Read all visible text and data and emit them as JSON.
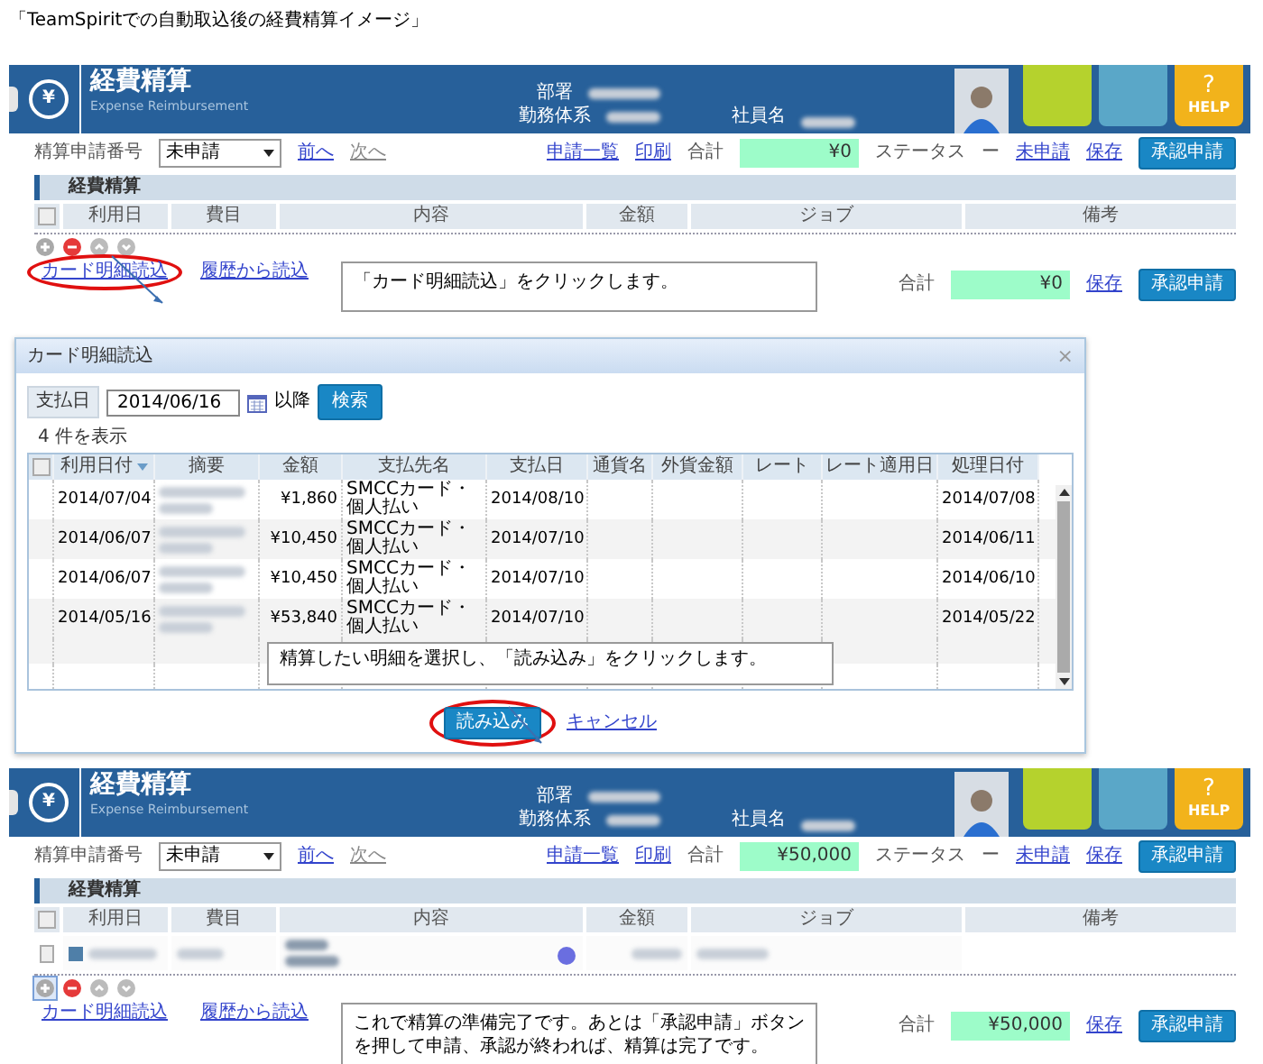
{
  "caption": "「TeamSpiritでの自動取込後の経費精算イメージ」",
  "screens": [
    {
      "header": {
        "yen": "¥",
        "title": "経費精算",
        "subtitle": "Expense Reimbursement",
        "dept_label": "部署",
        "work_label": "勤務体系",
        "employee_label": "社員名",
        "help_mark": "?",
        "help_label": "HELP"
      },
      "toolbar": {
        "number_label": "精算申請番号",
        "number_value": "未申請",
        "prev": "前へ",
        "next": "次へ",
        "list_link": "申請一覧",
        "print_link": "印刷",
        "total_label": "合計",
        "total": "¥0",
        "status_label": "ステータス",
        "status_dash": "ー",
        "status_link": "未申請",
        "save": "保存",
        "submit": "承認申請"
      },
      "section": "経費精算",
      "select_all_checked": false,
      "columns": [
        "利用日",
        "費目",
        "内容",
        "金額",
        "ジョブ",
        "備考"
      ],
      "add_selected": false,
      "card_link": "カード明細読込",
      "card_link_circled": true,
      "history_link": "履歴から読込",
      "callout": "「カード明細読込」をクリックします。",
      "footer": {
        "total_label": "合計",
        "total": "¥0",
        "save": "保存",
        "submit": "承認申請"
      }
    },
    {
      "header": {
        "yen": "¥",
        "title": "経費精算",
        "subtitle": "Expense Reimbursement",
        "dept_label": "部署",
        "work_label": "勤務体系",
        "employee_label": "社員名",
        "help_mark": "?",
        "help_label": "HELP"
      },
      "toolbar": {
        "number_label": "精算申請番号",
        "number_value": "未申請",
        "prev": "前へ",
        "next": "次へ",
        "list_link": "申請一覧",
        "print_link": "印刷",
        "total_label": "合計",
        "total": "¥50,000",
        "status_label": "ステータス",
        "status_dash": "ー",
        "status_link": "未申請",
        "save": "保存",
        "submit": "承認申請"
      },
      "section": "経費精算",
      "select_all_checked": false,
      "columns": [
        "利用日",
        "費目",
        "内容",
        "金額",
        "ジョブ",
        "備考"
      ],
      "rows": [
        {
          "kind": "blurred",
          "checked": false
        }
      ],
      "add_selected": true,
      "card_link": "カード明細読込",
      "card_link_circled": false,
      "history_link": "履歴から読込",
      "callout": "これで精算の準備完了です。あとは「承認申請」ボタンを押して申請、承認が終われば、精算は完了です。",
      "footer": {
        "total_label": "合計",
        "total": "¥50,000",
        "save": "保存",
        "submit": "承認申請"
      }
    }
  ],
  "dialog": {
    "title": "カード明細読込",
    "close": "×",
    "date_label": "支払日",
    "date": "2014/06/16",
    "after": "以降",
    "search": "検索",
    "count": "4 件を表示",
    "select_all_checked": false,
    "columns": [
      "利用日付",
      "摘要",
      "金額",
      "支払先名",
      "支払日",
      "通貨名",
      "外貨金額",
      "レート",
      "レート適用日",
      "処理日付"
    ],
    "rows": [
      {
        "date": "2014/07/04",
        "amount": "¥1,860",
        "payee": "SMCCカード・個人払い",
        "paid": "2014/08/10",
        "processed": "2014/07/08"
      },
      {
        "date": "2014/06/07",
        "amount": "¥10,450",
        "payee": "SMCCカード・個人払い",
        "paid": "2014/07/10",
        "processed": "2014/06/11"
      },
      {
        "date": "2014/06/07",
        "amount": "¥10,450",
        "payee": "SMCCカード・個人払い",
        "paid": "2014/07/10",
        "processed": "2014/06/10"
      },
      {
        "date": "2014/05/16",
        "amount": "¥53,840",
        "payee": "SMCCカード・個人払い",
        "paid": "2014/07/10",
        "processed": "2014/05/22"
      }
    ],
    "callout": "精算したい明細を選択し、「読み込み」をクリックします。",
    "load": "読み込み",
    "load_circled": true,
    "cancel": "キャンセル"
  }
}
